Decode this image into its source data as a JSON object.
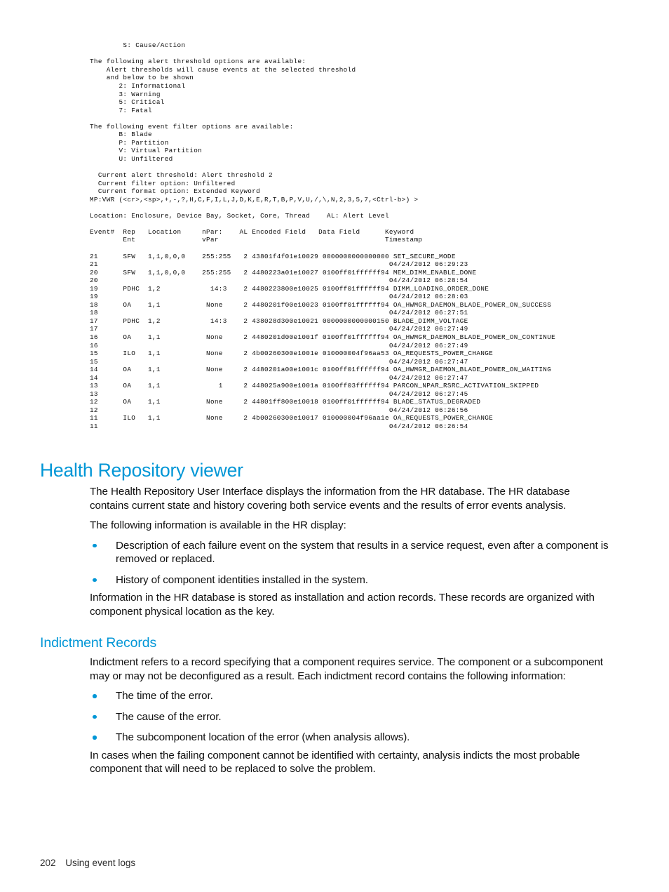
{
  "console": {
    "lines": [
      "        S: Cause/Action",
      "",
      "The following alert threshold options are available:",
      "    Alert thresholds will cause events at the selected threshold",
      "    and below to be shown",
      "       2: Informational",
      "       3: Warning",
      "       5: Critical",
      "       7: Fatal",
      "",
      "The following event filter options are available:",
      "       B: Blade",
      "       P: Partition",
      "       V: Virtual Partition",
      "       U: Unfiltered",
      "",
      "  Current alert threshold: Alert threshold 2",
      "  Current filter option: Unfiltered",
      "  Current format option: Extended Keyword",
      "MP:VWR (<cr>,<sp>,+,-,?,H,C,F,I,L,J,D,K,E,R,T,B,P,V,U,/,\\,N,2,3,5,7,<Ctrl-b>) >",
      "",
      "Location: Enclosure, Device Bay, Socket, Core, Thread    AL: Alert Level",
      "",
      "Event#  Rep   Location     nPar:    AL Encoded Field   Data Field      Keyword",
      "        Ent                vPar                                        Timestamp",
      "",
      "21      SFW   1,1,0,0,0    255:255   2 43801f4f01e10029 0000000000000000 SET_SECURE_MODE",
      "21                                                                      04/24/2012 06:29:23",
      "20      SFW   1,1,0,0,0    255:255   2 4480223a01e10027 0100ff01ffffff94 MEM_DIMM_ENABLE_DONE",
      "20                                                                      04/24/2012 06:28:54",
      "19      PDHC  1,2            14:3    2 4480223800e10025 0100ff01ffffff94 DIMM_LOADING_ORDER_DONE",
      "19                                                                      04/24/2012 06:28:03",
      "18      OA    1,1           None     2 4480201f00e10023 0100ff01ffffff94 OA_HWMGR_DAEMON_BLADE_POWER_ON_SUCCESS",
      "18                                                                      04/24/2012 06:27:51",
      "17      PDHC  1,2            14:3    2 438028d300e10021 0000000000000150 BLADE_DIMM_VOLTAGE",
      "17                                                                      04/24/2012 06:27:49",
      "16      OA    1,1           None     2 4480201d00e1001f 0100ff01ffffff94 OA_HWMGR_DAEMON_BLADE_POWER_ON_CONTINUE",
      "16                                                                      04/24/2012 06:27:49",
      "15      ILO   1,1           None     2 4b00260300e1001e 010000004f96aa53 OA_REQUESTS_POWER_CHANGE",
      "15                                                                      04/24/2012 06:27:47",
      "14      OA    1,1           None     2 4480201a00e1001c 0100ff01ffffff94 OA_HWMGR_DAEMON_BLADE_POWER_ON_WAITING",
      "14                                                                      04/24/2012 06:27:47",
      "13      OA    1,1              1     2 448025a900e1001a 0100ff03ffffff94 PARCON_NPAR_RSRC_ACTIVATION_SKIPPED",
      "13                                                                      04/24/2012 06:27:45",
      "12      OA    1,1           None     2 44801ff800e10018 0100ff01ffffff94 BLADE_STATUS_DEGRADED",
      "12                                                                      04/24/2012 06:26:56",
      "11      ILO   1,1           None     2 4b00260300e10017 010000004f96aa1e OA_REQUESTS_POWER_CHANGE",
      "11                                                                      04/24/2012 06:26:54"
    ],
    "event_table": {
      "columns": [
        "Event#",
        "Rep Ent",
        "Location",
        "nPar: vPar",
        "AL",
        "Encoded Field",
        "Data Field",
        "Keyword",
        "Timestamp"
      ],
      "rows": [
        {
          "event": "21",
          "rep_ent": "SFW",
          "location": "1,1,0,0,0",
          "npar_vpar": "255:255",
          "al": "2",
          "encoded_field": "43801f4f01e10029",
          "data_field": "0000000000000000",
          "keyword": "SET_SECURE_MODE",
          "timestamp": "04/24/2012 06:29:23"
        },
        {
          "event": "20",
          "rep_ent": "SFW",
          "location": "1,1,0,0,0",
          "npar_vpar": "255:255",
          "al": "2",
          "encoded_field": "4480223a01e10027",
          "data_field": "0100ff01ffffff94",
          "keyword": "MEM_DIMM_ENABLE_DONE",
          "timestamp": "04/24/2012 06:28:54"
        },
        {
          "event": "19",
          "rep_ent": "PDHC",
          "location": "1,2",
          "npar_vpar": "14:3",
          "al": "2",
          "encoded_field": "4480223800e10025",
          "data_field": "0100ff01ffffff94",
          "keyword": "DIMM_LOADING_ORDER_DONE",
          "timestamp": "04/24/2012 06:28:03"
        },
        {
          "event": "18",
          "rep_ent": "OA",
          "location": "1,1",
          "npar_vpar": "None",
          "al": "2",
          "encoded_field": "4480201f00e10023",
          "data_field": "0100ff01ffffff94",
          "keyword": "OA_HWMGR_DAEMON_BLADE_POWER_ON_SUCCESS",
          "timestamp": "04/24/2012 06:27:51"
        },
        {
          "event": "17",
          "rep_ent": "PDHC",
          "location": "1,2",
          "npar_vpar": "14:3",
          "al": "2",
          "encoded_field": "438028d300e10021",
          "data_field": "0000000000000150",
          "keyword": "BLADE_DIMM_VOLTAGE",
          "timestamp": "04/24/2012 06:27:49"
        },
        {
          "event": "16",
          "rep_ent": "OA",
          "location": "1,1",
          "npar_vpar": "None",
          "al": "2",
          "encoded_field": "4480201d00e1001f",
          "data_field": "0100ff01ffffff94",
          "keyword": "OA_HWMGR_DAEMON_BLADE_POWER_ON_CONTINUE",
          "timestamp": "04/24/2012 06:27:49"
        },
        {
          "event": "15",
          "rep_ent": "ILO",
          "location": "1,1",
          "npar_vpar": "None",
          "al": "2",
          "encoded_field": "4b00260300e1001e",
          "data_field": "010000004f96aa53",
          "keyword": "OA_REQUESTS_POWER_CHANGE",
          "timestamp": "04/24/2012 06:27:47"
        },
        {
          "event": "14",
          "rep_ent": "OA",
          "location": "1,1",
          "npar_vpar": "None",
          "al": "2",
          "encoded_field": "4480201a00e1001c",
          "data_field": "0100ff01ffffff94",
          "keyword": "OA_HWMGR_DAEMON_BLADE_POWER_ON_WAITING",
          "timestamp": "04/24/2012 06:27:47"
        },
        {
          "event": "13",
          "rep_ent": "OA",
          "location": "1,1",
          "npar_vpar": "1",
          "al": "2",
          "encoded_field": "448025a900e1001a",
          "data_field": "0100ff03ffffff94",
          "keyword": "PARCON_NPAR_RSRC_ACTIVATION_SKIPPED",
          "timestamp": "04/24/2012 06:27:45"
        },
        {
          "event": "12",
          "rep_ent": "OA",
          "location": "1,1",
          "npar_vpar": "None",
          "al": "2",
          "encoded_field": "44801ff800e10018",
          "data_field": "0100ff01ffffff94",
          "keyword": "BLADE_STATUS_DEGRADED",
          "timestamp": "04/24/2012 06:26:56"
        },
        {
          "event": "11",
          "rep_ent": "ILO",
          "location": "1,1",
          "npar_vpar": "None",
          "al": "2",
          "encoded_field": "4b00260300e10017",
          "data_field": "010000004f96aa1e",
          "keyword": "OA_REQUESTS_POWER_CHANGE",
          "timestamp": "04/24/2012 06:26:54"
        }
      ]
    },
    "prompt": "MP:VWR (<cr>,<sp>,+,-,?,H,C,F,I,L,J,D,K,E,R,T,B,P,V,U,/,\\,N,2,3,5,7,<Ctrl-b>) >"
  },
  "health_repository": {
    "title": "Health Repository viewer",
    "paragraph_1": "The Health Repository User Interface displays the information from the HR database. The HR database contains current state and history covering both service events and the results of error events analysis.",
    "paragraph_2": "The following information is available in the HR display:",
    "bullets": [
      "Description of each failure event on the system that results in a service request, even after a component is removed or replaced.",
      "History of component identities installed in the system."
    ],
    "paragraph_3": "Information in the HR database is stored as installation and action records. These records are organized with component physical location as the key."
  },
  "indictment_records": {
    "title": "Indictment Records",
    "paragraph_1": "Indictment refers to a record specifying that a component requires service. The component or a subcomponent may or may not be deconfigured as a result. Each indictment record contains the following information:",
    "bullets": [
      "The time of the error.",
      "The cause of the error.",
      "The subcomponent location of the error (when analysis allows)."
    ],
    "paragraph_2": "In cases when the failing component cannot be identified with certainty, analysis indicts the most probable component that will need to be replaced to solve the problem."
  },
  "footer": {
    "page_number": "202",
    "chapter": "Using event logs"
  },
  "colors": {
    "heading_blue": "#0096d6",
    "bullet_blue": "#0096d6",
    "body_text": "#101010",
    "page_background": "#ffffff"
  }
}
